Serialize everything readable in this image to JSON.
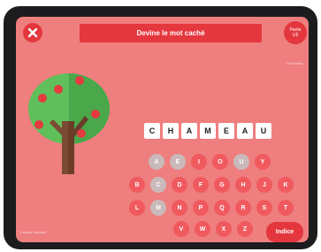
{
  "header": {
    "title": "Devine le mot caché",
    "round_label": "Partie",
    "round_value": "1/5",
    "top_right_text": "Fond blanc"
  },
  "word": {
    "letters": [
      "C",
      "H",
      "A",
      "M",
      "E",
      "A",
      "U"
    ]
  },
  "keyboard": {
    "rows": [
      [
        {
          "l": "A",
          "used": true
        },
        {
          "l": "E",
          "used": true
        },
        {
          "l": "I",
          "used": false
        },
        {
          "l": "O",
          "used": false
        },
        {
          "l": "U",
          "used": true
        },
        {
          "l": "Y",
          "used": false
        }
      ],
      [
        {
          "l": "B",
          "used": false
        },
        {
          "l": "C",
          "used": true
        },
        {
          "l": "D",
          "used": false
        },
        {
          "l": "F",
          "used": false
        },
        {
          "l": "G",
          "used": false
        },
        {
          "l": "H",
          "used": false
        },
        {
          "l": "J",
          "used": false
        },
        {
          "l": "K",
          "used": false
        }
      ],
      [
        {
          "l": "L",
          "used": false
        },
        {
          "l": "M",
          "used": true
        },
        {
          "l": "N",
          "used": false
        },
        {
          "l": "P",
          "used": false
        },
        {
          "l": "Q",
          "used": false
        },
        {
          "l": "R",
          "used": false
        },
        {
          "l": "S",
          "used": false
        },
        {
          "l": "T",
          "used": false
        }
      ],
      [
        {
          "l": "V",
          "used": false
        },
        {
          "l": "W",
          "used": false
        },
        {
          "l": "X",
          "used": false
        },
        {
          "l": "Z",
          "used": false
        }
      ]
    ]
  },
  "footer": {
    "hint_label": "Indice",
    "bottom_left_text": "3 essais restants"
  },
  "colors": {
    "background": "#ef7e7e",
    "accent": "#e3363d",
    "key": "#f05a5f",
    "key_used": "#c9b9ba"
  },
  "icons": {
    "close": "close-icon",
    "tree": "apple-tree-illustration"
  }
}
